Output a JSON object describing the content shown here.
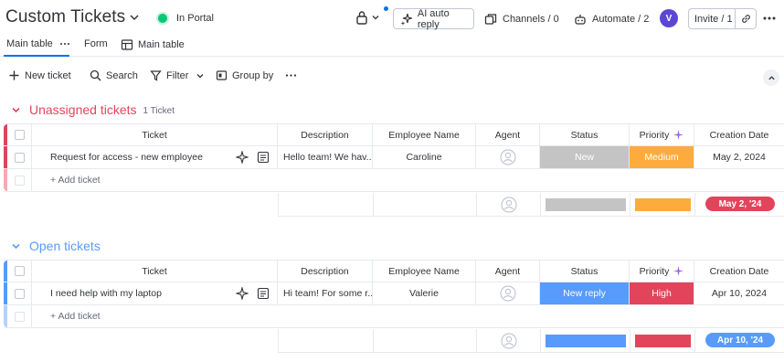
{
  "header": {
    "title": "Custom Tickets",
    "portal_label": "In Portal",
    "ai_reply_label": "AI auto reply",
    "channels_label": "Channels / 0",
    "automate_label": "Automate / 2",
    "avatar_initial": "V",
    "invite_label": "Invite / 1"
  },
  "tabs": [
    {
      "label": "Main table"
    },
    {
      "label": "Form"
    },
    {
      "label": "Main table"
    }
  ],
  "toolbar": {
    "new_ticket": "New ticket",
    "search": "Search",
    "filter": "Filter",
    "group_by": "Group by"
  },
  "columns": {
    "ticket": "Ticket",
    "description": "Description",
    "employee_name": "Employee Name",
    "agent": "Agent",
    "status": "Status",
    "priority": "Priority",
    "creation_date": "Creation Date"
  },
  "groups": [
    {
      "title": "Unassigned tickets",
      "count": "1 Ticket",
      "color": "#e2445c",
      "rows": [
        {
          "ticket": "Request for access - new employee",
          "description": "Hello team! We hav...",
          "employee_name": "Caroline",
          "status": "New",
          "status_color": "#c4c4c4",
          "priority": "Medium",
          "priority_color": "#fdab3d",
          "creation_date": "May 2, 2024"
        }
      ],
      "add_label": "+ Add ticket",
      "summary_date": "May 2, '24"
    },
    {
      "title": "Open tickets",
      "count": "",
      "color": "#579bfc",
      "rows": [
        {
          "ticket": "I need help with my laptop",
          "description": "Hi team! For some r...",
          "employee_name": "Valerie",
          "status": "New reply",
          "status_color": "#579bfc",
          "priority": "High",
          "priority_color": "#e2445c",
          "creation_date": "Apr 10, 2024"
        }
      ],
      "add_label": "+ Add ticket",
      "summary_date": "Apr 10, '24"
    }
  ],
  "colors": {
    "accent": "#0073ea",
    "unassigned": "#e2445c",
    "open": "#579bfc",
    "status_new": "#c4c4c4",
    "status_new_reply": "#579bfc",
    "priority_medium": "#fdab3d",
    "priority_high": "#e2445c",
    "portal_dot": "#00c875",
    "avatar": "#5b47d6"
  }
}
